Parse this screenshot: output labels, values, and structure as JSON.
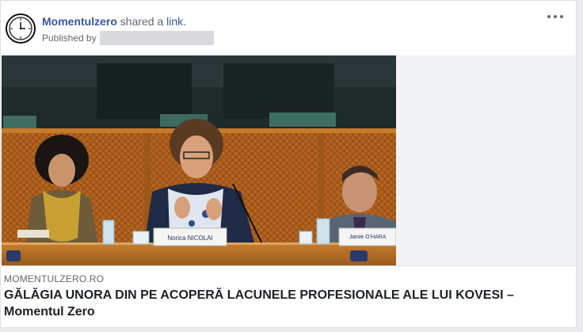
{
  "post": {
    "page_name": "Momentulzero",
    "verb": "shared a",
    "link_word": "link.",
    "published_by_label": "Published by",
    "more_menu_icon": "more-horizontal-icon"
  },
  "media": {
    "nameplates": {
      "center": "Norica NICOLAI",
      "right": "Jamie O'HARA"
    }
  },
  "link_preview": {
    "domain": "MOMENTULZERO.RO",
    "title_line1": "GĂLĂGIA UNORA DIN PE ACOPERĂ LACUNELE PROFESIONALE ALE LUI KOVESI –",
    "title_line2": "Momentul Zero"
  },
  "colors": {
    "link_blue": "#365899",
    "text_dark": "#1d2129",
    "text_muted": "#606770",
    "border": "#dddfe2",
    "page_bg": "#e9ebee"
  }
}
